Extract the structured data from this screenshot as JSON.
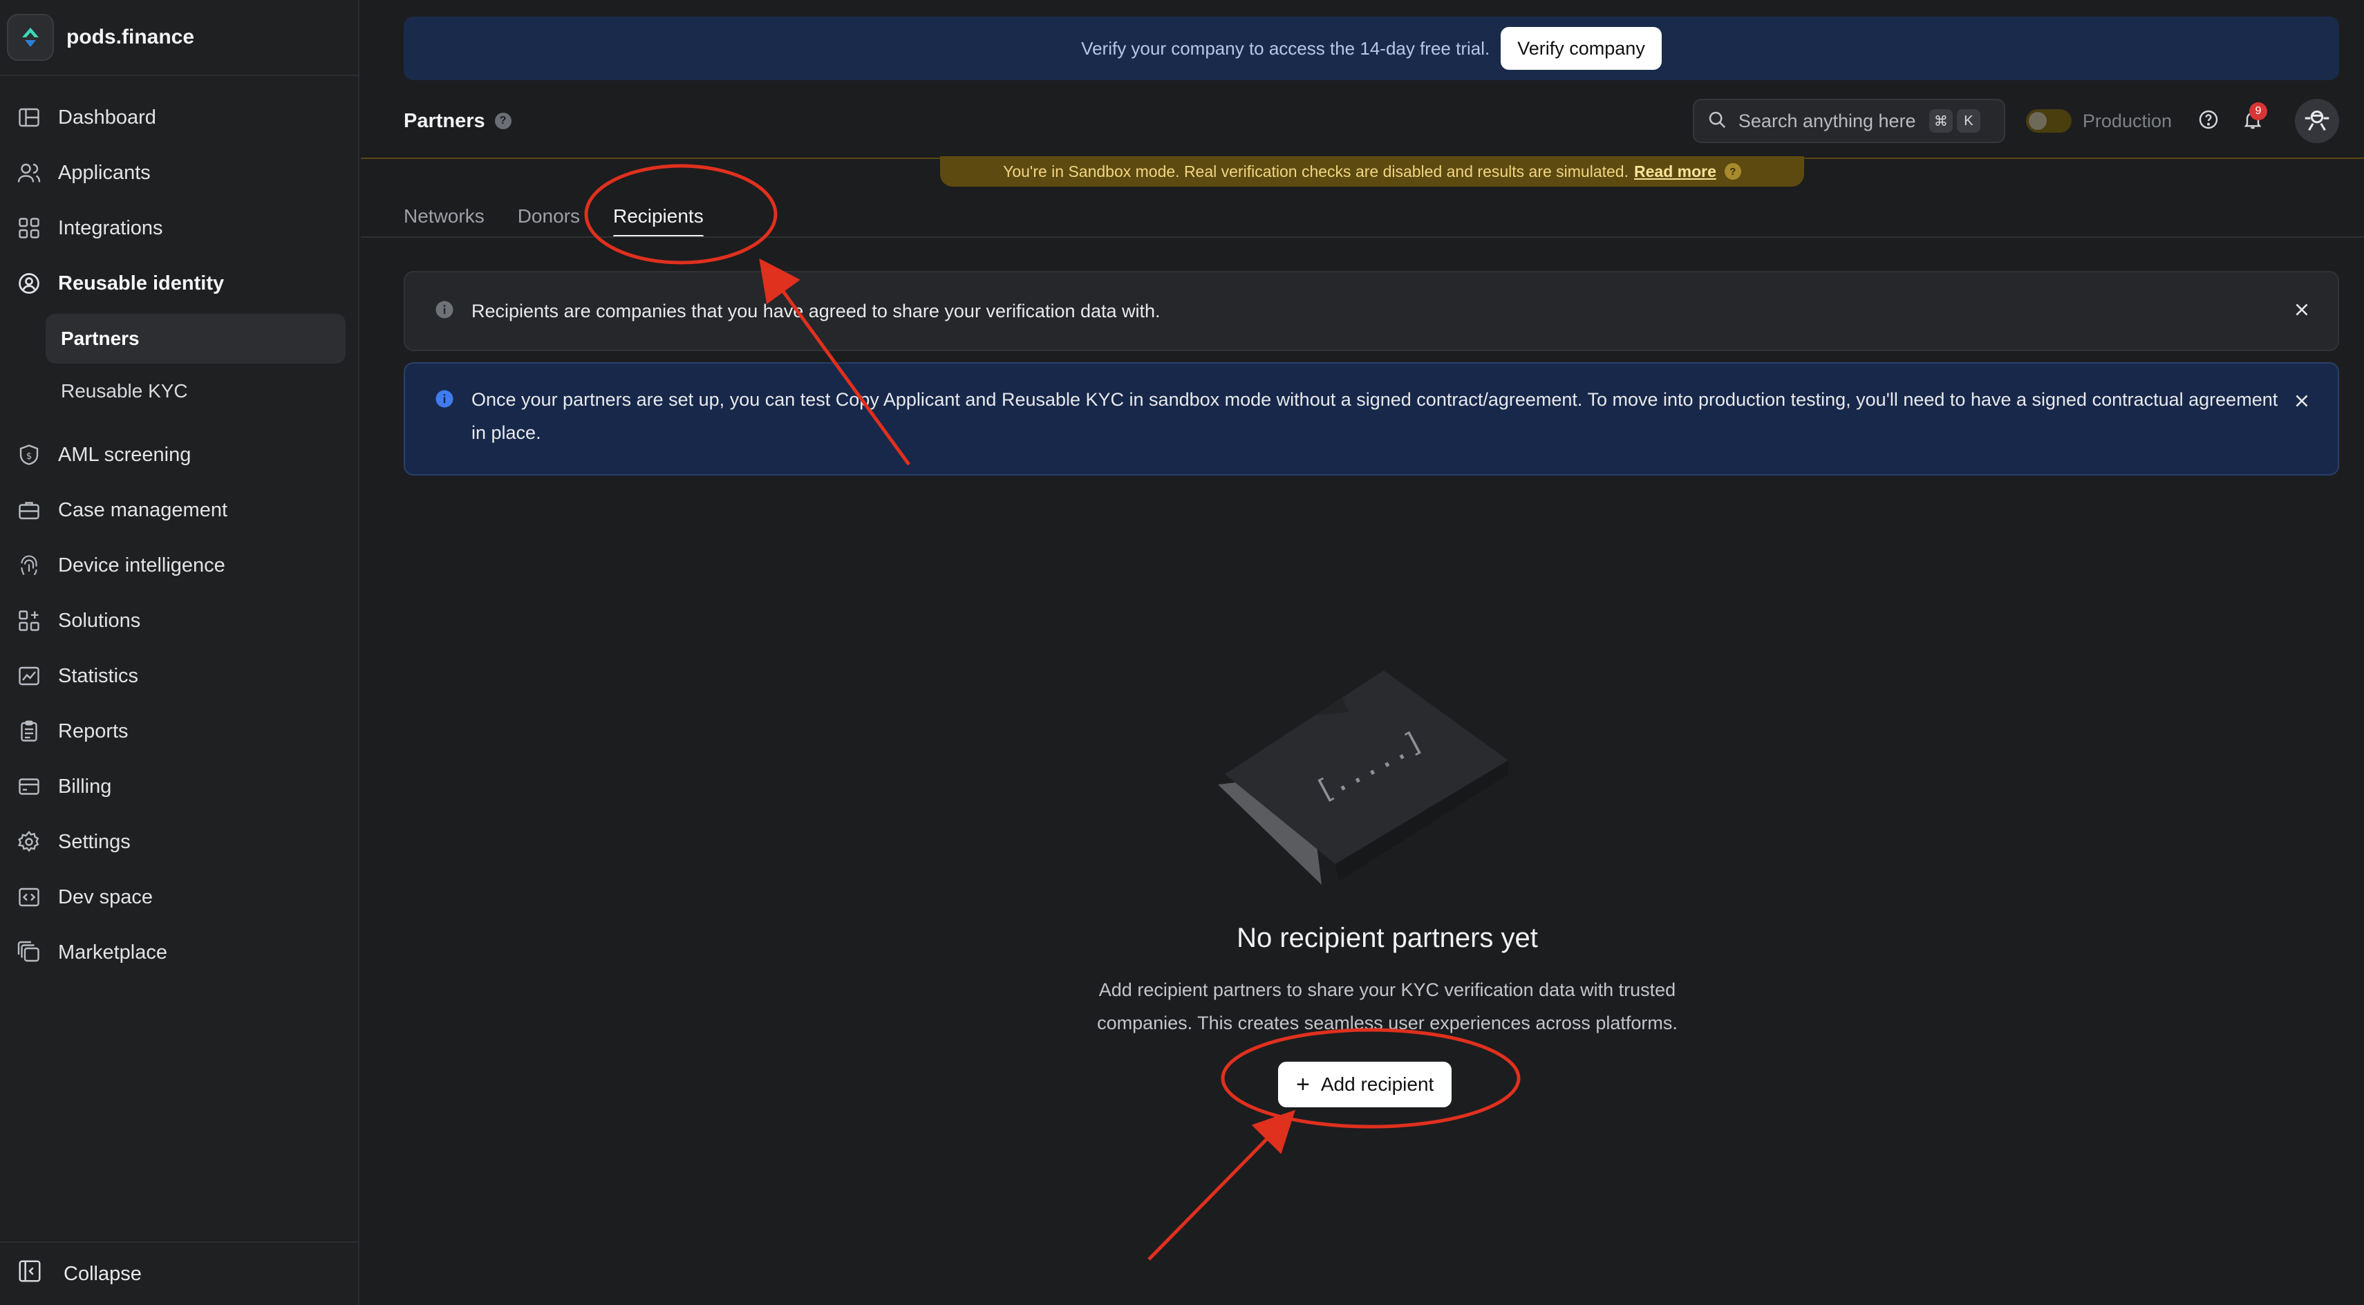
{
  "brand": {
    "name": "pods.finance"
  },
  "sidebar": {
    "items": [
      {
        "label": "Dashboard",
        "icon": "dashboard-icon"
      },
      {
        "label": "Applicants",
        "icon": "users-icon"
      },
      {
        "label": "Integrations",
        "icon": "grid-icon"
      },
      {
        "label": "Reusable identity",
        "icon": "identity-icon"
      },
      {
        "label": "AML screening",
        "icon": "shield-icon"
      },
      {
        "label": "Case management",
        "icon": "briefcase-icon"
      },
      {
        "label": "Device intelligence",
        "icon": "fingerprint-icon"
      },
      {
        "label": "Solutions",
        "icon": "apps-icon"
      },
      {
        "label": "Statistics",
        "icon": "chart-icon"
      },
      {
        "label": "Reports",
        "icon": "clipboard-icon"
      },
      {
        "label": "Billing",
        "icon": "card-icon"
      },
      {
        "label": "Settings",
        "icon": "gear-icon"
      },
      {
        "label": "Dev space",
        "icon": "code-icon"
      },
      {
        "label": "Marketplace",
        "icon": "marketplace-icon"
      }
    ],
    "sub_items": [
      {
        "label": "Partners"
      },
      {
        "label": "Reusable KYC"
      }
    ],
    "collapse_label": "Collapse"
  },
  "banner": {
    "text": "Verify your company to access the 14-day free trial.",
    "button_label": "Verify company"
  },
  "header": {
    "title": "Partners",
    "help_symbol": "?",
    "search_placeholder": "Search anything here",
    "shortcut_cmd": "⌘",
    "shortcut_key": "K",
    "environment_label": "Production",
    "notification_count": "9"
  },
  "sandbox": {
    "text": "You're in Sandbox mode. Real verification checks are disabled and results are simulated.",
    "link": "Read more",
    "help_symbol": "?"
  },
  "tabs": [
    {
      "label": "Networks"
    },
    {
      "label": "Donors"
    },
    {
      "label": "Recipients"
    }
  ],
  "alerts": {
    "info": "Recipients are companies that you have agreed to share your verification data with.",
    "notice": "Once your partners are set up, you can test Copy Applicant and Reusable KYC in sandbox mode without a signed contract/agreement. To move into production testing, you'll need to have a signed contractual agreement in place."
  },
  "empty_state": {
    "title": "No recipient partners yet",
    "description_line1": "Add recipient partners to share your KYC verification data with trusted",
    "description_line2": "companies. This creates seamless user experiences across platforms.",
    "button_label": "Add recipient"
  },
  "annotation_color": "#e0301e"
}
